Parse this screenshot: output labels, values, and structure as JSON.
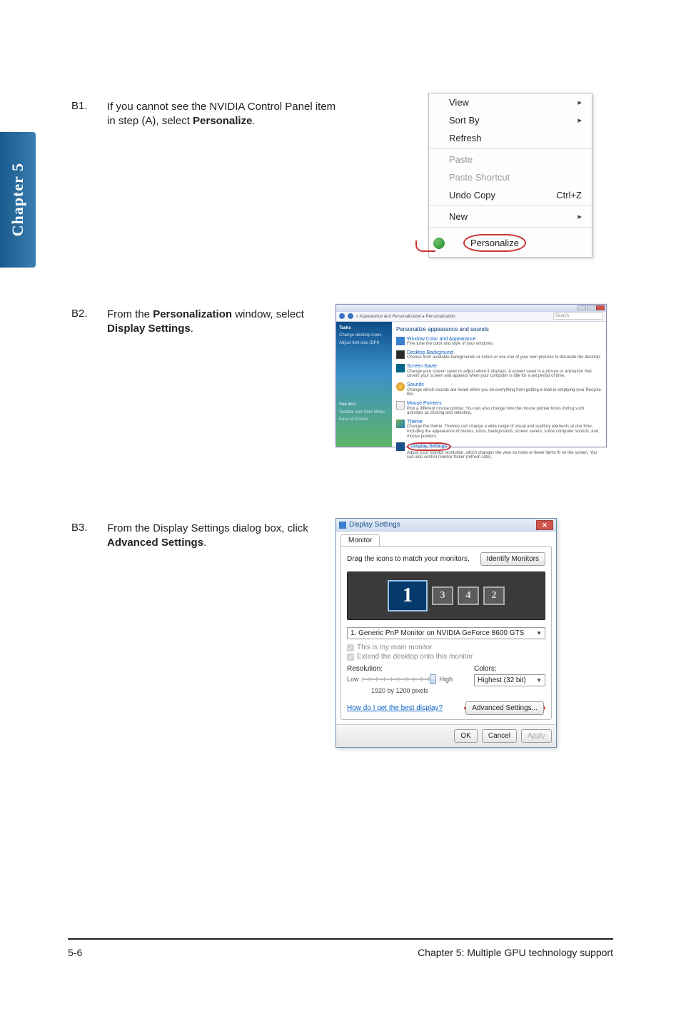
{
  "sidebar": {
    "chapter_label": "Chapter 5"
  },
  "steps": {
    "b1": {
      "num": "B1.",
      "text_pre": "If you cannot see the NVIDIA Control Panel item in step (A), select ",
      "text_bold": "Personalize",
      "text_post": "."
    },
    "b2": {
      "num": "B2.",
      "text_pre": "From the ",
      "bold1": "Personalization",
      "mid": " window, select ",
      "bold2": "Display Settings",
      "post": "."
    },
    "b3": {
      "num": "B3.",
      "text_pre": "From the Display Settings dialog box, click ",
      "bold": "Advanced Settings",
      "post": "."
    }
  },
  "context_menu": {
    "view": "View",
    "sort": "Sort By",
    "refresh": "Refresh",
    "paste": "Paste",
    "paste_shortcut": "Paste Shortcut",
    "undo_copy": "Undo Copy",
    "undo_shortcut": "Ctrl+Z",
    "new": "New",
    "personalize": "Personalize"
  },
  "pers_window": {
    "breadcrumb": "« Appearance and Personalization ▸ Personalization",
    "search": "Search",
    "sidebar": {
      "tasks": "Tasks",
      "change_icons": "Change desktop icons",
      "adjust_font": "Adjust font size (DPI)",
      "see_also": "See also",
      "taskbar": "Taskbar and Start Menu",
      "ease": "Ease of Access"
    },
    "headline": "Personalize appearance and sounds",
    "entries": [
      {
        "t": "Window Color and Appearance",
        "d": "Fine tune the color and style of your windows."
      },
      {
        "t": "Desktop Background",
        "d": "Choose from available backgrounds or colors or use one of your own pictures to decorate the desktop."
      },
      {
        "t": "Screen Saver",
        "d": "Change your screen saver or adjust when it displays. A screen saver is a picture or animation that covers your screen and appears when your computer is idle for a set period of time."
      },
      {
        "t": "Sounds",
        "d": "Change which sounds are heard when you do everything from getting e-mail to emptying your Recycle Bin."
      },
      {
        "t": "Mouse Pointers",
        "d": "Pick a different mouse pointer. You can also change how the mouse pointer looks during such activities as clicking and selecting."
      },
      {
        "t": "Theme",
        "d": "Change the theme. Themes can change a wide range of visual and auditory elements at one time, including the appearance of menus, icons, backgrounds, screen savers, some computer sounds, and mouse pointers."
      },
      {
        "t": "Display Settings",
        "d": "Adjust your monitor resolution, which changes the view so more or fewer items fit on the screen. You can also control monitor flicker (refresh rate)."
      }
    ]
  },
  "display_settings": {
    "title": "Display Settings",
    "tab": "Monitor",
    "drag_text": "Drag the icons to match your monitors.",
    "identify": "Identify Monitors",
    "monitors": {
      "main": "1",
      "m3": "3",
      "m4": "4",
      "m2": "2"
    },
    "monitor_select": "1. Generic PnP Monitor on NVIDIA GeForce 8600 GTS",
    "chk_main": "This is my main monitor",
    "chk_extend": "Extend the desktop onto this monitor",
    "resolution_label": "Resolution:",
    "low": "Low",
    "high": "High",
    "resolution_value": "1920 by 1200 pixels",
    "colors_label": "Colors:",
    "colors_value": "Highest (32 bit)",
    "help_link": "How do I get the best display?",
    "advanced": "Advanced Settings...",
    "ok": "OK",
    "cancel": "Cancel",
    "apply": "Apply"
  },
  "footer": {
    "left": "5-6",
    "right": "Chapter 5: Multiple GPU technology support"
  }
}
